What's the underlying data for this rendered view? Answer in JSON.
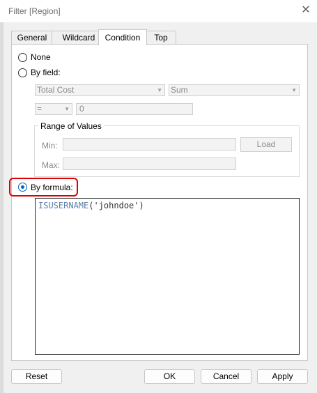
{
  "window": {
    "title": "Filter [Region]"
  },
  "tabs": [
    {
      "label": "General"
    },
    {
      "label": "Wildcard"
    },
    {
      "label": "Condition"
    },
    {
      "label": "Top"
    }
  ],
  "condition": {
    "none_label": "None",
    "by_field_label": "By field:",
    "field_select": "Total Cost",
    "aggregation_select": "Sum",
    "operator_select": "=",
    "value_input": "0",
    "range_group_label": "Range of Values",
    "min_label": "Min:",
    "max_label": "Max:",
    "load_button": "Load",
    "by_formula_label": "By formula:",
    "formula_function": "ISUSERNAME",
    "formula_args": "('johndoe')",
    "selected": "by_formula"
  },
  "buttons": {
    "reset": "Reset",
    "ok": "OK",
    "cancel": "Cancel",
    "apply": "Apply"
  },
  "colors": {
    "annotation": "#dd0000",
    "radio_selected": "#0067c0"
  }
}
